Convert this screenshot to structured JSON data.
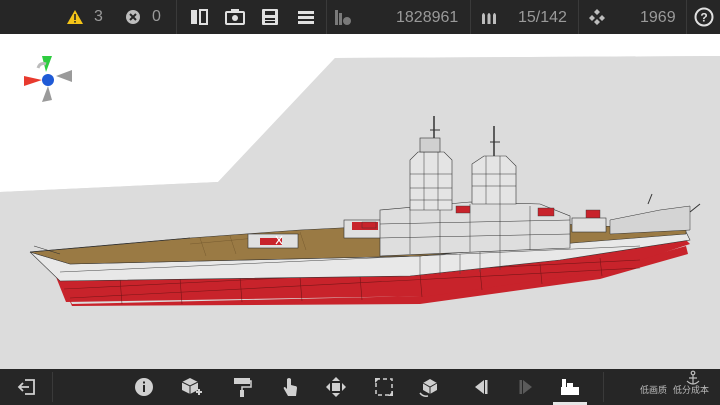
{
  "topbar": {
    "warnings": {
      "icon": "warning-triangle-icon",
      "count": "3",
      "color": "#f5c518"
    },
    "errors": {
      "icon": "error-x-icon",
      "count": "0"
    },
    "tools": [
      "split-view-icon",
      "screenshot-camera-icon",
      "save-disk-icon",
      "menu-hamburger-icon"
    ],
    "displacement": {
      "icon": "weight-stack-icon",
      "value": "1828961"
    },
    "ammo": {
      "icon": "ammo-shells-icon",
      "value": "15/142"
    },
    "parts": {
      "icon": "parts-stack-icon",
      "value": "1969"
    },
    "help": {
      "icon": "help-question-icon"
    }
  },
  "viewport": {
    "background": "#d8d8d8",
    "gizmo": "orientation-gizmo",
    "ship": {
      "hull_red": "#c8232b",
      "deck_tan": "#9a7a44",
      "superstructure": "#dedede"
    }
  },
  "bottombar": {
    "exit": "exit-icon",
    "tools": [
      "info-icon",
      "add-block-icon",
      "paint-roller-icon",
      "touch-hand-icon",
      "move-arrows-icon",
      "resize-frame-icon",
      "rotate-block-icon",
      "step-back-icon",
      "step-forward-icon",
      "layers-icon"
    ],
    "active_tool": "layers-icon",
    "quality_low": "低画质",
    "low_cost": "低分成本"
  }
}
